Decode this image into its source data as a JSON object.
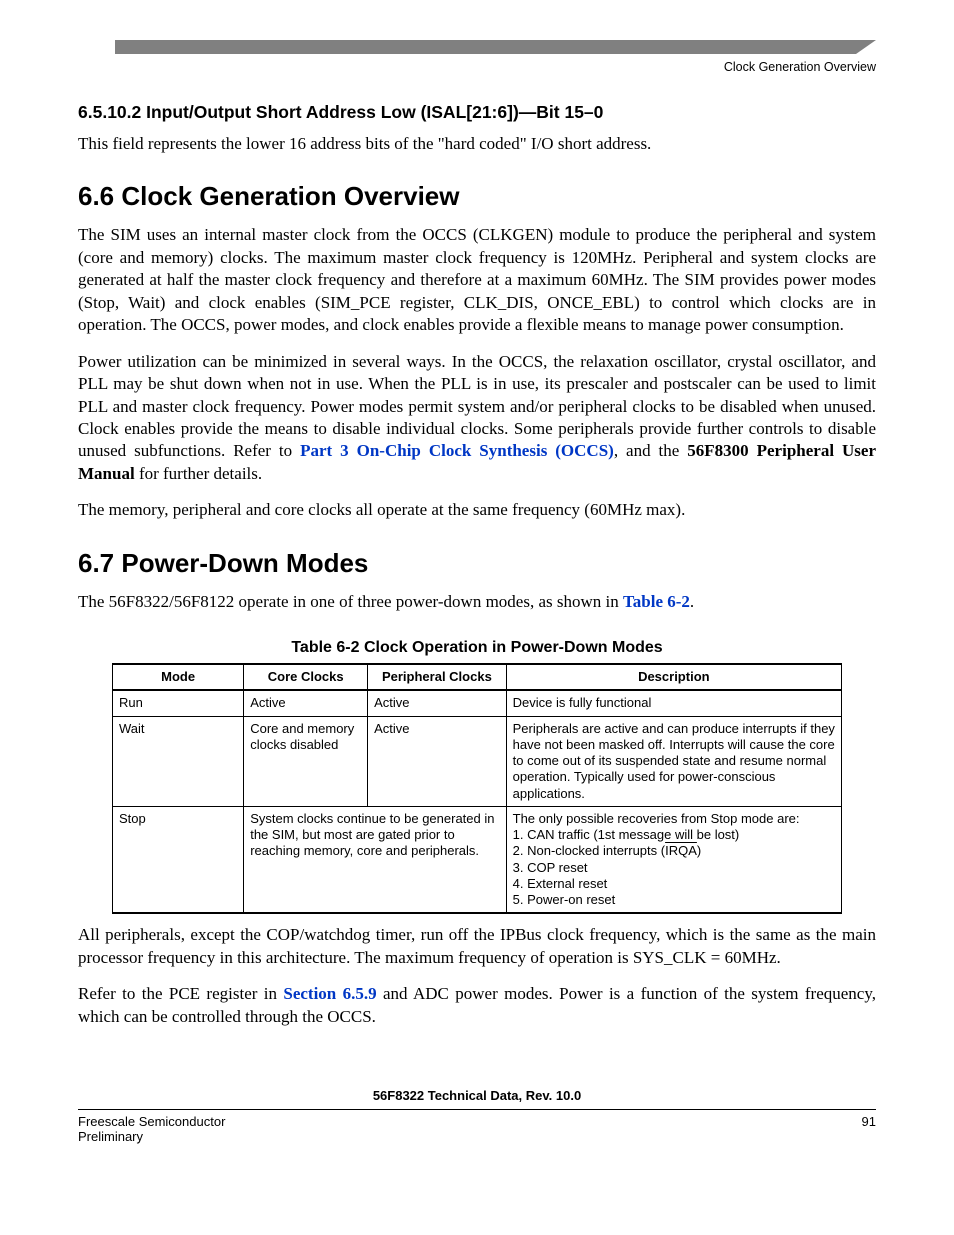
{
  "runhead": "Clock Generation Overview",
  "sec65102": {
    "heading": "6.5.10.2   Input/Output Short Address Low (ISAL[21:6])—Bit 15–0",
    "p1": "This field represents the lower 16 address bits of the \"hard coded\" I/O short address."
  },
  "sec66": {
    "heading": "6.6  Clock Generation Overview",
    "p1": "The SIM uses an internal master clock from the OCCS (CLKGEN) module to produce the peripheral and system (core and memory) clocks. The maximum master clock frequency is 120MHz. Peripheral and system clocks are generated at half the master clock frequency and therefore at a maximum 60MHz. The SIM provides power modes (Stop, Wait) and clock enables (SIM_PCE register, CLK_DIS, ONCE_EBL) to control which clocks are in operation. The OCCS, power modes, and clock enables provide a flexible means to manage power consumption.",
    "p2a": "Power utilization can be minimized in several ways. In the OCCS, the relaxation oscillator, crystal oscillator, and PLL may be shut down when not in use. When the PLL is in use, its prescaler and postscaler can be used to limit PLL and master clock frequency. Power modes permit system and/or peripheral clocks to be disabled when unused. Clock enables provide the means to disable individual clocks. Some peripherals provide further controls to disable unused subfunctions. Refer to ",
    "p2_link1": "Part 3 On-Chip Clock Synthesis (OCCS)",
    "p2b": ", and the ",
    "p2_bold": "56F8300 Peripheral User Manual",
    "p2c": " for further details.",
    "p3": "The memory, peripheral and core clocks all operate at the same frequency (60MHz max)."
  },
  "sec67": {
    "heading": "6.7  Power-Down Modes",
    "p1a": "The 56F8322/56F8122 operate in one of three power-down modes, as shown in ",
    "p1_link": "Table 6-2",
    "p1b": ".",
    "table_caption": "Table 6-2 Clock Operation in Power-Down Modes",
    "cols": {
      "c1": "Mode",
      "c2": "Core Clocks",
      "c3": "Peripheral Clocks",
      "c4": "Description"
    },
    "rows": [
      {
        "mode": "Run",
        "core": "Active",
        "periph": "Active",
        "desc": "Device is fully functional"
      },
      {
        "mode": "Wait",
        "core": "Core and memory clocks disabled",
        "periph": "Active",
        "desc": "Peripherals are active and can produce interrupts if they have not been masked off. Interrupts will cause the core to come out of its suspended state and resume normal operation. Typically used for power-conscious applications."
      },
      {
        "mode": "Stop",
        "core_span": "System clocks continue to be generated in the SIM, but most are gated prior to reaching memory, core and peripherals.",
        "desc_pre": "The only possible recoveries from Stop mode are:\n1. CAN traffic (1st message will be lost)\n2. Non-clocked interrupts (",
        "desc_irqa": "IRQA",
        "desc_post": ")\n3. COP reset\n4. External reset\n5. Power-on reset"
      }
    ],
    "p2": "All peripherals, except the COP/watchdog timer, run off the IPBus clock frequency, which is the same as the main processor frequency in this architecture. The maximum frequency of operation is SYS_CLK = 60MHz.",
    "p3a": "Refer to the PCE register in ",
    "p3_link": "Section 6.5.9",
    "p3b": "  and ADC power modes. Power is a function of the system frequency, which can be controlled through the OCCS."
  },
  "footer": {
    "center": "56F8322 Technical Data, Rev. 10.0",
    "left1": "Freescale Semiconductor",
    "left2": "Preliminary",
    "right": "91"
  }
}
